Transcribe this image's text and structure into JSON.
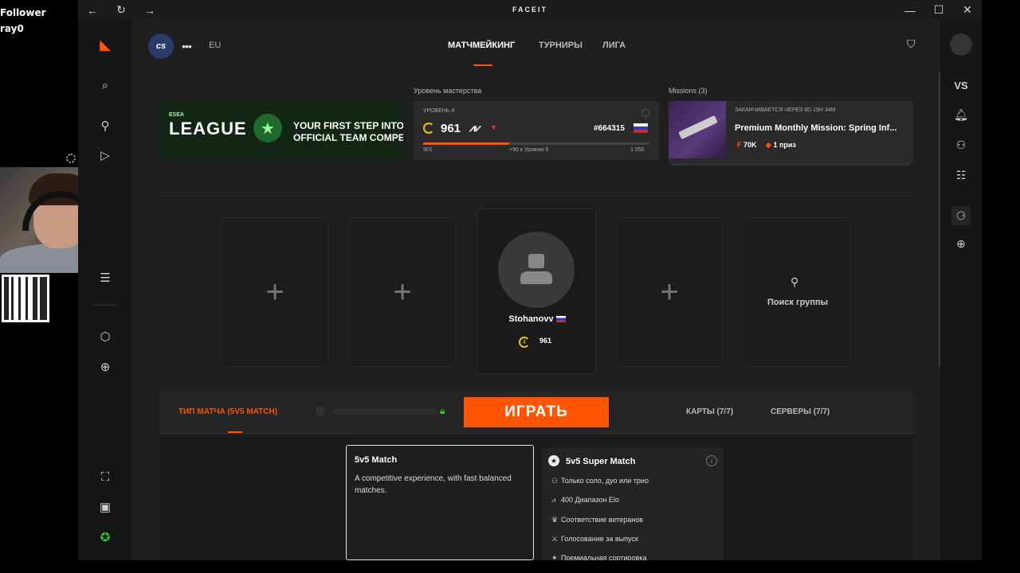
{
  "overlay": {
    "line1": "Follower",
    "line2": "ray0"
  },
  "window": {
    "brand": "FACEIT",
    "back": "←",
    "reload": "↻",
    "forward": "→",
    "minimize": "—",
    "maximize": "☐",
    "close": "✕"
  },
  "topnav": {
    "game": "cs",
    "more": "•••",
    "region": "EU",
    "tabs": [
      "МАТЧМЕЙКИНГ",
      "ТУРНИРЫ",
      "ЛИГА"
    ]
  },
  "banner": {
    "esea": "ESEA",
    "league": "LEAGUE",
    "tagline_1": "YOUR FIRST STEP INTO",
    "tagline_2": "OFFICIAL TEAM COMPETITIC"
  },
  "skill": {
    "label": "Уровень мастерства",
    "level_text": "УРОВЕНЬ 4",
    "elo": "961",
    "trend": "⩘⩗",
    "caret": "▼",
    "rank": "#664315",
    "progress_fraction": 0.38,
    "min": "901",
    "next": "+90 к Уровню 5",
    "max": "1 050"
  },
  "missions": {
    "label": "Missions (3)",
    "expires": "ЗАКАНЧИВАЕТСЯ ЧЕРЕЗ 8D 19H 34M",
    "title": "Premium Monthly Mission: Spring Inf...",
    "reward": "70K",
    "prize": "1 приз"
  },
  "party": {
    "plus": "+",
    "player_name": "Stohanovv",
    "player_level": "4",
    "player_elo": "961",
    "search_label": "Поиск группы"
  },
  "match_bar": {
    "match_type": "ТИП МАТЧА (5V5 MATCH)",
    "play": "ИГРАТЬ",
    "maps": "КАРТЫ (7/7)",
    "servers": "СЕРВЕРЫ (7/7)"
  },
  "modes": {
    "normal": {
      "title": "5v5 Match",
      "desc": "A competitive experience, with fast balanced matches."
    },
    "super": {
      "title": "5v5 Super Match",
      "features": [
        "Только соло, дуо или трио",
        "400 Диапазон Elo",
        "Соответствие ветеранов",
        "Голосование за выпуск",
        "Премиальная сортировка"
      ]
    }
  },
  "colors": {
    "accent": "#ff5500",
    "level_yellow": "#f5c400",
    "lock_green": "#37c837"
  }
}
